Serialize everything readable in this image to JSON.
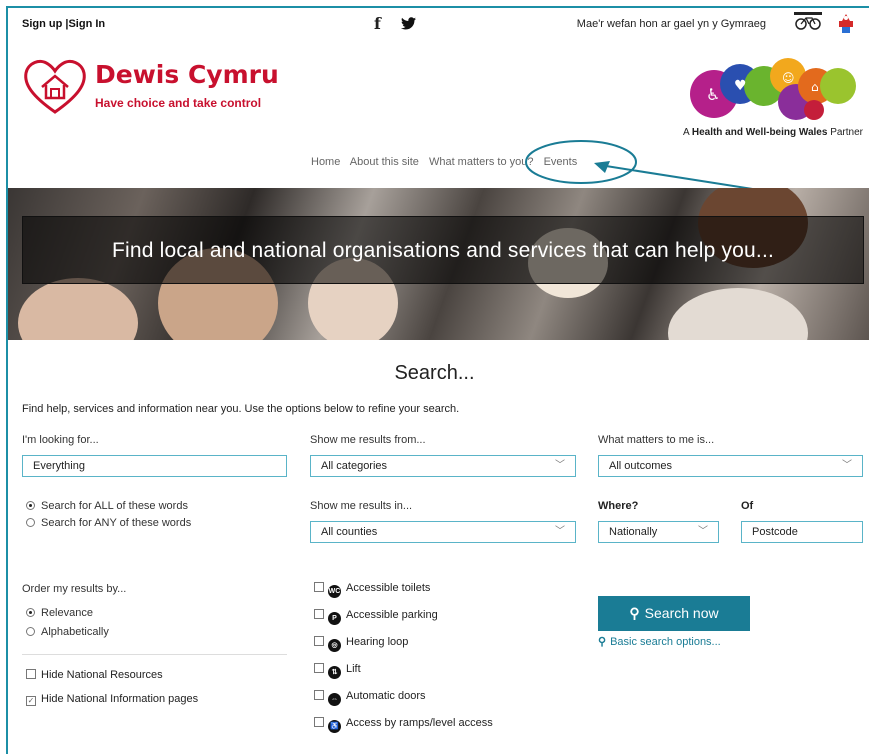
{
  "topbar": {
    "sign_up": "Sign up |",
    "sign_in": "Sign In",
    "facebook_glyph": "f",
    "twitter_glyph": "🐦",
    "welsh_notice": "Mae'r wefan hon ar gael yn y Gymraeg"
  },
  "logo": {
    "title": "Dewis Cymru",
    "tagline": "Have choice and take control"
  },
  "partner": {
    "prefix": "A ",
    "bold": "Health and Well-being Wales",
    "suffix": " Partner"
  },
  "nav": {
    "home": "Home",
    "about": "About this site",
    "matters": "What matters to you?",
    "events": "Events"
  },
  "hero": {
    "text": "Find local and national organisations and services that can help you..."
  },
  "search": {
    "title": "Search...",
    "intro": "Find help, services and information near you. Use the options below to refine your search.",
    "looking_for_label": "I'm looking for...",
    "looking_for_value": "Everything",
    "results_from_label": "Show me results from...",
    "results_from_value": "All categories",
    "matters_label": "What matters to me is...",
    "matters_value": "All outcomes",
    "all_words": "Search for ALL of these words",
    "any_words": "Search for ANY of these words",
    "results_in_label": "Show me results in...",
    "results_in_value": "All counties",
    "where_label": "Where?",
    "where_value": "Nationally",
    "of_label": "Of",
    "postcode_value": "Postcode",
    "order_label": "Order my results by...",
    "order_relevance": "Relevance",
    "order_alpha": "Alphabetically",
    "hide_national_resources": "Hide National Resources",
    "hide_national_info": "Hide National Information pages",
    "facilities": [
      {
        "label": "Accessible toilets",
        "icon": "toilet-icon"
      },
      {
        "label": "Accessible parking",
        "icon": "parking-icon"
      },
      {
        "label": "Hearing loop",
        "icon": "hearing-loop-icon"
      },
      {
        "label": "Lift",
        "icon": "lift-icon"
      },
      {
        "label": "Automatic doors",
        "icon": "automatic-doors-icon"
      },
      {
        "label": "Access by ramps/level access",
        "icon": "wheelchair-icon"
      }
    ],
    "search_button": "Search now",
    "basic_link": "Basic search options..."
  },
  "colors": {
    "brand_red": "#c8102e",
    "teal": "#1a7c95",
    "field_border": "#5ab4c8"
  }
}
